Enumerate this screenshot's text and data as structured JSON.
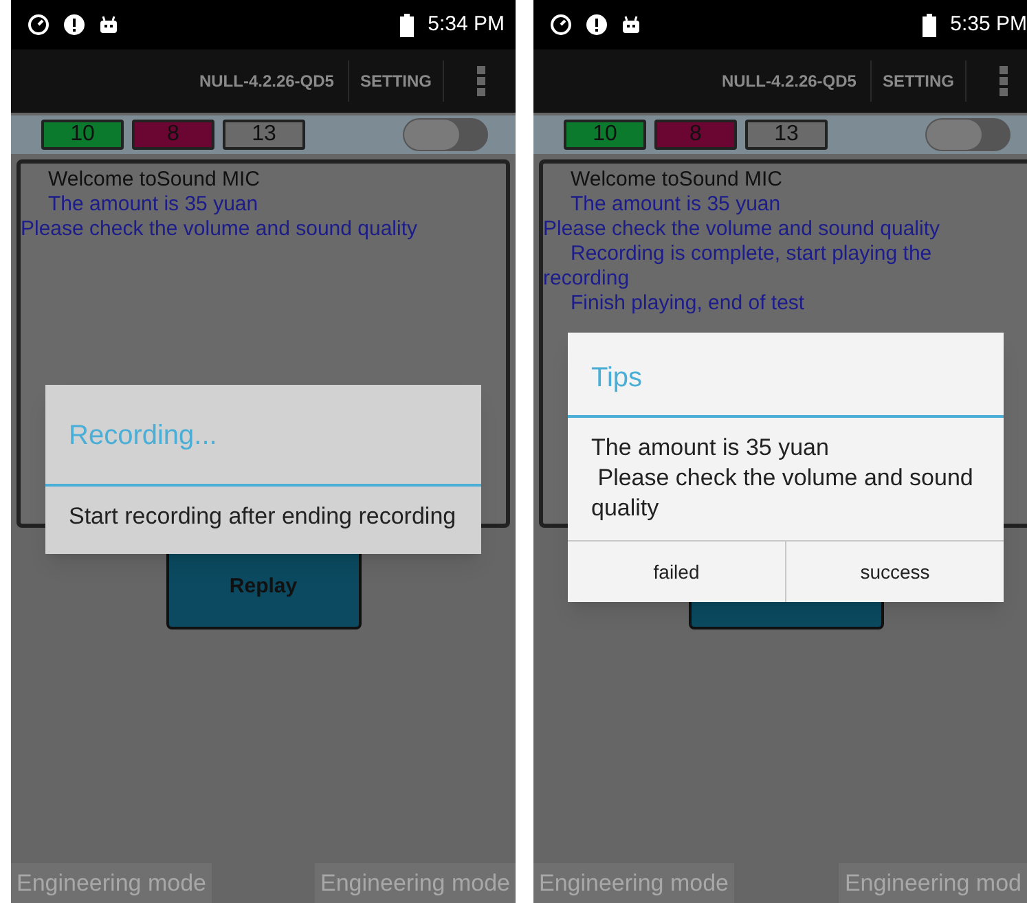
{
  "screens": [
    {
      "status_bar": {
        "time": "5:34 PM"
      },
      "action_bar": {
        "title": "NULL-4.2.26-QD5",
        "setting": "SETTING"
      },
      "counters": [
        {
          "value": "10",
          "color": "#0b7a2c"
        },
        {
          "value": "8",
          "color": "#6b0532"
        },
        {
          "value": "13",
          "color": "#6a6a6a"
        }
      ],
      "toggle": {
        "on": false
      },
      "log": [
        {
          "text": "Welcome toSound MIC",
          "kind": "title",
          "indent": true
        },
        {
          "text": "The amount is 35 yuan",
          "kind": "message",
          "indent": true
        },
        {
          "text": "Please check the volume and sound quality",
          "kind": "message",
          "indent": false
        }
      ],
      "replay_button": "Replay",
      "dialog": {
        "kind": "progress",
        "title": "Recording...",
        "message": "Start recording after ending recording"
      },
      "footer": [
        "Engineering mode",
        "Engineering mode"
      ]
    },
    {
      "status_bar": {
        "time": "5:35 PM"
      },
      "action_bar": {
        "title": "NULL-4.2.26-QD5",
        "setting": "SETTING"
      },
      "counters": [
        {
          "value": "10",
          "color": "#0b7a2c"
        },
        {
          "value": "8",
          "color": "#6b0532"
        },
        {
          "value": "13",
          "color": "#6a6a6a"
        }
      ],
      "toggle": {
        "on": false
      },
      "log": [
        {
          "text": "Welcome toSound MIC",
          "kind": "title",
          "indent": true
        },
        {
          "text": "The amount is 35 yuan",
          "kind": "message",
          "indent": true
        },
        {
          "text": "Please check the volume and sound quality",
          "kind": "message",
          "indent": false
        },
        {
          "text": "Recording is complete, start playing the recording",
          "kind": "message",
          "indent": true
        },
        {
          "text": "Finish playing, end of test",
          "kind": "message",
          "indent": true
        }
      ],
      "dialog": {
        "kind": "alert",
        "title": "Tips",
        "message": "The amount is 35 yuan\n Please check the volume and sound quality",
        "buttons": [
          "failed",
          "success"
        ]
      },
      "footer": [
        "Engineering mode",
        "Engineering mod"
      ]
    }
  ]
}
